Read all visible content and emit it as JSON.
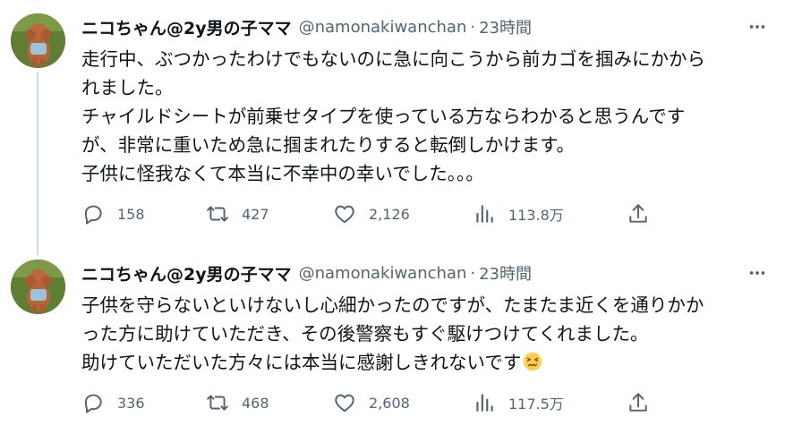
{
  "tweets": [
    {
      "author_name": "ニコちゃん@2y男の子ママ",
      "handle": "@namonakiwanchan",
      "separator": "·",
      "time": "23時間",
      "lines": [
        "走行中、ぶつかったわけでもないのに急に向こうから前カゴを掴みにかから",
        "れました。",
        "チャイルドシートが前乗せタイプを使っている方ならわかると思うんです",
        "が、非常に重いため急に掴まれたりすると転倒しかけます。",
        "子供に怪我なくて本当に不幸中の幸いでした。。。"
      ],
      "replies": "158",
      "retweets": "427",
      "likes": "2,126",
      "views": "113.8万"
    },
    {
      "author_name": "ニコちゃん@2y男の子ママ",
      "handle": "@namonakiwanchan",
      "separator": "·",
      "time": "23時間",
      "lines": [
        "子供を守らないといけないし心細かったのですが、たまたま近くを通りかか",
        "った方に助けていただき、その後警察もすぐ駆けつけてくれました。",
        "助けていただいた方々には本当に感謝しきれないです"
      ],
      "emoji": "confounded-face",
      "replies": "336",
      "retweets": "468",
      "likes": "2,608",
      "views": "117.5万"
    }
  ],
  "icons": {
    "reply": "reply-icon",
    "retweet": "retweet-icon",
    "like": "heart-icon",
    "views": "views-chart-icon",
    "share": "share-icon",
    "more": "more-options-icon"
  },
  "colors": {
    "text_primary": "#0f1419",
    "text_secondary": "#536471",
    "thread_line": "#cfd9de",
    "background": "#ffffff"
  }
}
